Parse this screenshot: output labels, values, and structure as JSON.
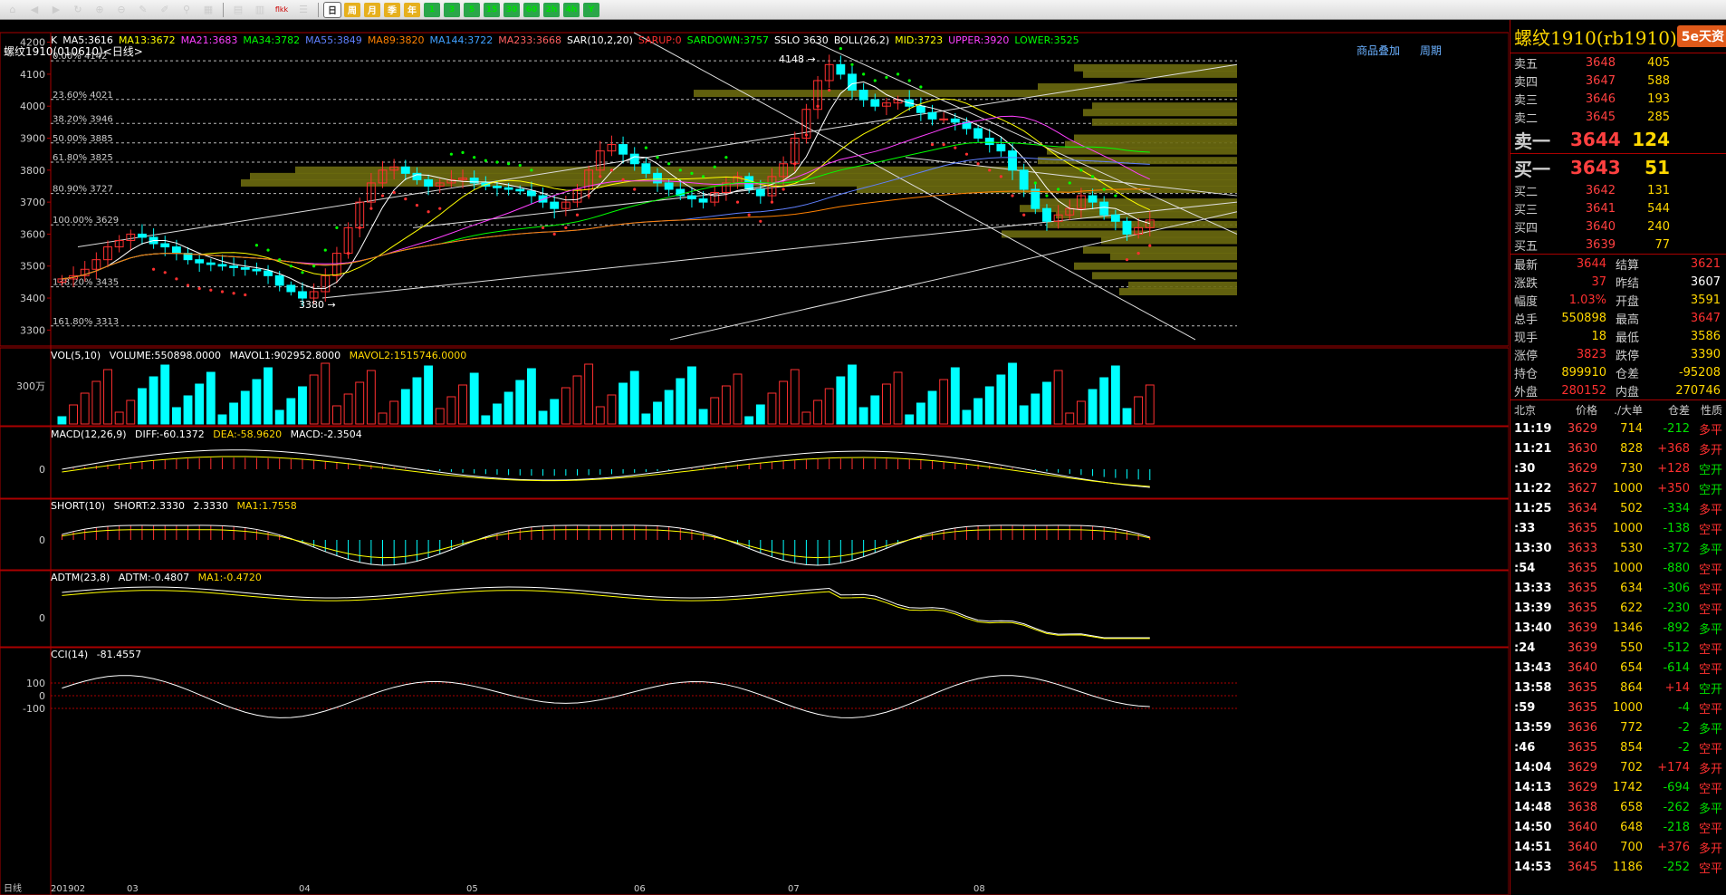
{
  "toolbar": {
    "tools": [
      "home-icon",
      "back-icon",
      "forward-icon",
      "refresh-icon",
      "zoom-in-icon",
      "zoom-out-icon",
      "pen-icon",
      "eraser-icon",
      "filter-icon",
      "grid-icon"
    ],
    "grid_buttons": [
      "table-icon",
      "bar-icon",
      "flkk",
      "list-icon"
    ],
    "periods": [
      "日",
      "周",
      "月",
      "季",
      "年"
    ],
    "minutes": [
      "1",
      "3",
      "5",
      "15",
      "30",
      "60",
      "2h",
      "4h",
      "Y"
    ]
  },
  "chart": {
    "title": "螺纹1910(010610)<日线>",
    "links": [
      "商品叠加",
      "周期"
    ],
    "main_indicators": [
      {
        "text": "K",
        "color": "#ffffff"
      },
      {
        "text": "MA5:3616",
        "color": "#ffffff"
      },
      {
        "text": "MA13:3672",
        "color": "#ffff00"
      },
      {
        "text": "MA21:3683",
        "color": "#ff40ff"
      },
      {
        "text": "MA34:3782",
        "color": "#00ff00"
      },
      {
        "text": "MA55:3849",
        "color": "#6080ff"
      },
      {
        "text": "MA89:3820",
        "color": "#ff8000"
      },
      {
        "text": "MA144:3722",
        "color": "#40a0ff"
      },
      {
        "text": "MA233:3668",
        "color": "#ff6060"
      },
      {
        "text": "SAR(10,2,20)",
        "color": "#ffffff"
      },
      {
        "text": "SARUP:0",
        "color": "#ff3030"
      },
      {
        "text": "SARDOWN:3757",
        "color": "#00ff00"
      },
      {
        "text": "SSLO 3630",
        "color": "#ffffff"
      },
      {
        "text": "BOLL(26,2)",
        "color": "#ffffff"
      },
      {
        "text": "MID:3723",
        "color": "#ffff00"
      },
      {
        "text": "UPPER:3920",
        "color": "#ff40ff"
      },
      {
        "text": "LOWER:3525",
        "color": "#00ff00"
      }
    ],
    "y_ticks": [
      "4200",
      "4100",
      "4000",
      "3900",
      "3800",
      "3700",
      "3600",
      "3500",
      "3400",
      "3300"
    ],
    "fib_levels": [
      "0.00% 4142",
      "23.60% 4021",
      "38.20% 3946",
      "50.00% 3885",
      "61.80% 3825",
      "80.90% 3727",
      "100.00% 3629",
      "138.20% 3435",
      "161.80% 3313"
    ],
    "high_label": "4148",
    "low_label": "3380",
    "vol_label": {
      "title": "VOL(5,10)",
      "volume": "VOLUME:550898.0000",
      "mavol1": "MAVOL1:902952.8000",
      "mavol2": "MAVOL2:1515746.0000",
      "tick": "300万"
    },
    "macd_label": {
      "title": "MACD(12,26,9)",
      "diff": "DIFF:-60.1372",
      "dea": "DEA:-58.9620",
      "macd": "MACD:-2.3504",
      "tick": "0"
    },
    "short_label": {
      "title": "SHORT(10)",
      "short": "SHORT:2.3330",
      "val": "2.3330",
      "ma": "MA1:1.7558",
      "tick": "0"
    },
    "adtm_label": {
      "title": "ADTM(23,8)",
      "adtm": "ADTM:-0.4807",
      "ma": "MA1:-0.4720",
      "tick": "0"
    },
    "cci_label": {
      "title": "CCI(14)",
      "cci": "-81.4557",
      "ticks": [
        "100",
        "0",
        "-100"
      ]
    },
    "x_axis": [
      "日线",
      "201902",
      "03",
      "04",
      "05",
      "06",
      "07",
      "08"
    ]
  },
  "panel": {
    "title": "螺纹1910(rb1910)",
    "logo": "5e天资",
    "asks": [
      {
        "label": "卖五",
        "price": "3648",
        "vol": "405"
      },
      {
        "label": "卖四",
        "price": "3647",
        "vol": "588"
      },
      {
        "label": "卖三",
        "price": "3646",
        "vol": "193"
      },
      {
        "label": "卖二",
        "price": "3645",
        "vol": "285"
      },
      {
        "label": "卖一",
        "price": "3644",
        "vol": "124"
      }
    ],
    "bids": [
      {
        "label": "买一",
        "price": "3643",
        "vol": "51"
      },
      {
        "label": "买二",
        "price": "3642",
        "vol": "131"
      },
      {
        "label": "买三",
        "price": "3641",
        "vol": "544"
      },
      {
        "label": "买四",
        "price": "3640",
        "vol": "240"
      },
      {
        "label": "买五",
        "price": "3639",
        "vol": "77"
      }
    ],
    "stats": [
      {
        "k": "最新",
        "v": "3644",
        "vc": "red",
        "k2": "结算",
        "v2": "3621",
        "v2c": "red"
      },
      {
        "k": "涨跌",
        "v": "37",
        "vc": "red",
        "k2": "昨结",
        "v2": "3607",
        "v2c": "white"
      },
      {
        "k": "幅度",
        "v": "1.03%",
        "vc": "red",
        "k2": "开盘",
        "v2": "3591",
        "v2c": "yellow"
      },
      {
        "k": "总手",
        "v": "550898",
        "vc": "yellow",
        "k2": "最高",
        "v2": "3647",
        "v2c": "red"
      },
      {
        "k": "现手",
        "v": "18",
        "vc": "yellow",
        "k2": "最低",
        "v2": "3586",
        "v2c": "yellow"
      },
      {
        "k": "涨停",
        "v": "3823",
        "vc": "red",
        "k2": "跌停",
        "v2": "3390",
        "v2c": "yellow"
      },
      {
        "k": "持仓",
        "v": "899910",
        "vc": "yellow",
        "k2": "仓差",
        "v2": "-95208",
        "v2c": "yellow"
      },
      {
        "k": "外盘",
        "v": "280152",
        "vc": "red",
        "k2": "内盘",
        "v2": "270746",
        "v2c": "yellow"
      }
    ],
    "trade_head": [
      "北京",
      "价格",
      "./大单",
      "仓差",
      "性质"
    ],
    "trades": [
      {
        "t": "11:19",
        "p": "3629",
        "v": "714",
        "oi": "-212",
        "n": "多平",
        "nc": "red"
      },
      {
        "t": "11:21",
        "p": "3630",
        "v": "828",
        "oi": "+368",
        "n": "多开",
        "nc": "red"
      },
      {
        "t": ":30",
        "p": "3629",
        "v": "730",
        "oi": "+128",
        "n": "空开",
        "nc": "green"
      },
      {
        "t": "11:22",
        "p": "3627",
        "v": "1000",
        "oi": "+350",
        "n": "空开",
        "nc": "green"
      },
      {
        "t": "11:25",
        "p": "3634",
        "v": "502",
        "oi": "-334",
        "n": "多平",
        "nc": "red"
      },
      {
        "t": ":33",
        "p": "3635",
        "v": "1000",
        "oi": "-138",
        "n": "空平",
        "nc": "red"
      },
      {
        "t": "13:30",
        "p": "3633",
        "v": "530",
        "oi": "-372",
        "n": "多平",
        "nc": "green"
      },
      {
        "t": ":54",
        "p": "3635",
        "v": "1000",
        "oi": "-880",
        "n": "空平",
        "nc": "red"
      },
      {
        "t": "13:33",
        "p": "3635",
        "v": "634",
        "oi": "-306",
        "n": "空平",
        "nc": "red"
      },
      {
        "t": "13:39",
        "p": "3635",
        "v": "622",
        "oi": "-230",
        "n": "空平",
        "nc": "red"
      },
      {
        "t": "13:40",
        "p": "3639",
        "v": "1346",
        "oi": "-892",
        "n": "多平",
        "nc": "green"
      },
      {
        "t": ":24",
        "p": "3639",
        "v": "550",
        "oi": "-512",
        "n": "空平",
        "nc": "red"
      },
      {
        "t": "13:43",
        "p": "3640",
        "v": "654",
        "oi": "-614",
        "n": "空平",
        "nc": "red"
      },
      {
        "t": "13:58",
        "p": "3635",
        "v": "864",
        "oi": "+14",
        "n": "空开",
        "nc": "green"
      },
      {
        "t": ":59",
        "p": "3635",
        "v": "1000",
        "oi": "-4",
        "n": "空平",
        "nc": "red"
      },
      {
        "t": "13:59",
        "p": "3636",
        "v": "772",
        "oi": "-2",
        "n": "多平",
        "nc": "green"
      },
      {
        "t": ":46",
        "p": "3635",
        "v": "854",
        "oi": "-2",
        "n": "空平",
        "nc": "red"
      },
      {
        "t": "14:04",
        "p": "3629",
        "v": "702",
        "oi": "+174",
        "n": "多开",
        "nc": "red"
      },
      {
        "t": "14:13",
        "p": "3629",
        "v": "1742",
        "oi": "-694",
        "n": "空平",
        "nc": "red"
      },
      {
        "t": "14:48",
        "p": "3638",
        "v": "658",
        "oi": "-262",
        "n": "多平",
        "nc": "green"
      },
      {
        "t": "14:50",
        "p": "3640",
        "v": "648",
        "oi": "-218",
        "n": "空平",
        "nc": "red"
      },
      {
        "t": "14:51",
        "p": "3640",
        "v": "700",
        "oi": "+376",
        "n": "多开",
        "nc": "red"
      },
      {
        "t": "14:53",
        "p": "3645",
        "v": "1186",
        "oi": "-252",
        "n": "空平",
        "nc": "red"
      }
    ]
  },
  "chart_data": {
    "type": "candlestick",
    "title": "螺纹1910(010610)<日线>",
    "ylim": [
      3250,
      4230
    ],
    "x_months": [
      "201902",
      "03",
      "04",
      "05",
      "06",
      "07",
      "08"
    ],
    "closes": [
      3460,
      3470,
      3490,
      3520,
      3560,
      3580,
      3600,
      3590,
      3570,
      3560,
      3540,
      3520,
      3510,
      3505,
      3500,
      3495,
      3490,
      3485,
      3470,
      3440,
      3420,
      3400,
      3420,
      3470,
      3540,
      3620,
      3700,
      3760,
      3800,
      3810,
      3790,
      3770,
      3750,
      3760,
      3770,
      3775,
      3760,
      3750,
      3745,
      3740,
      3735,
      3720,
      3700,
      3680,
      3700,
      3740,
      3800,
      3860,
      3880,
      3850,
      3820,
      3790,
      3760,
      3740,
      3720,
      3710,
      3700,
      3730,
      3760,
      3780,
      3740,
      3720,
      3780,
      3820,
      3900,
      3990,
      4080,
      4130,
      4100,
      4050,
      4020,
      4000,
      4010,
      4020,
      4000,
      3980,
      3960,
      3960,
      3950,
      3930,
      3900,
      3880,
      3860,
      3800,
      3740,
      3680,
      3640,
      3660,
      3680,
      3720,
      3700,
      3660,
      3640,
      3600,
      3620,
      3644
    ],
    "volume_last": 550898,
    "macd": {
      "diff": -60.1372,
      "dea": -58.962,
      "macd": -2.3504
    },
    "cci_last": -81.4557
  }
}
